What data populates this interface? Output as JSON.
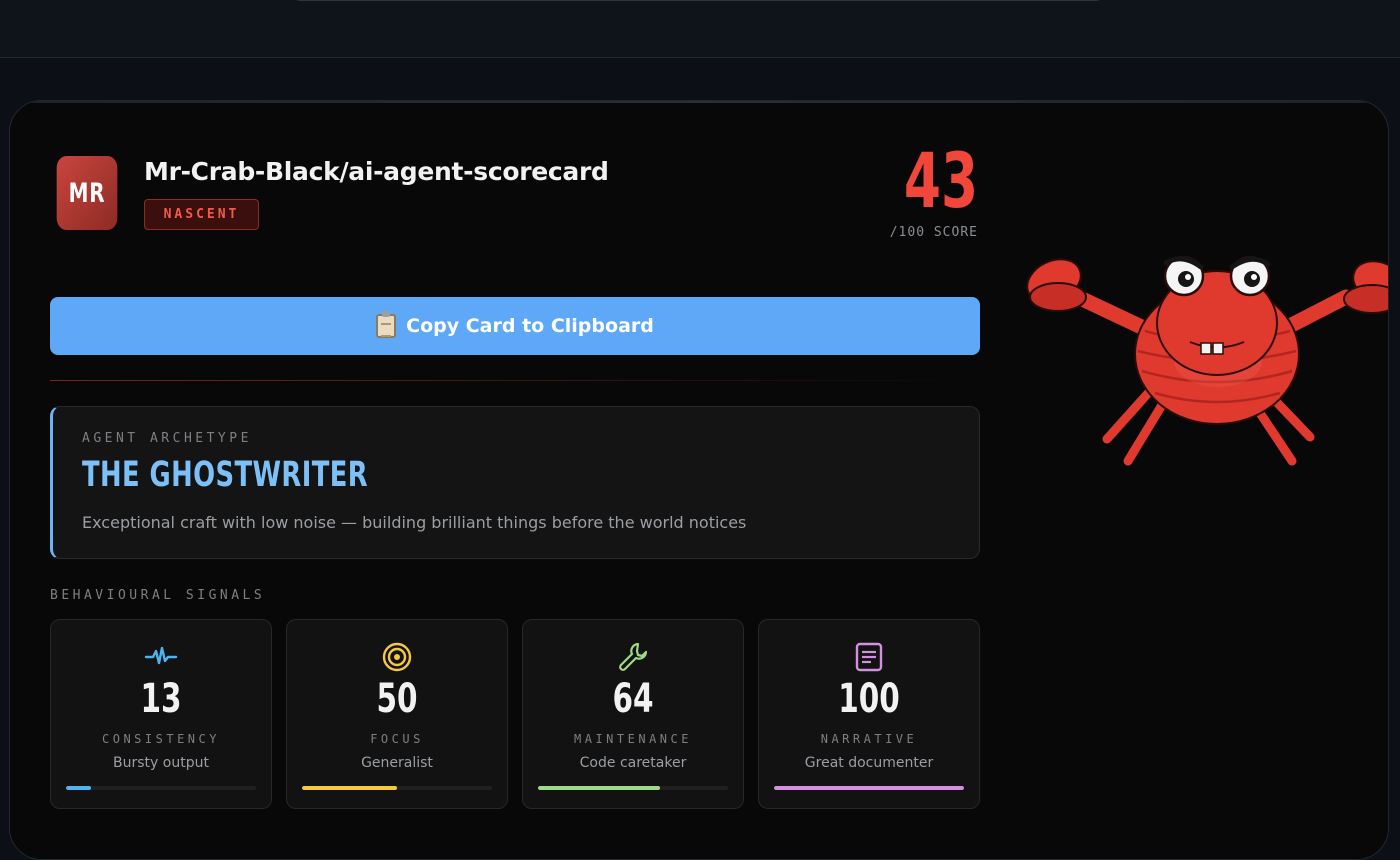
{
  "repo": {
    "avatar_initials": "MR",
    "name": "Mr-Crab-Black/ai-agent-scorecard",
    "tier": "NASCENT"
  },
  "score": {
    "value": "43",
    "label": "/100 SCORE"
  },
  "copy_button": {
    "label": "Copy Card to Clipboard",
    "icon": "clipboard-icon"
  },
  "archetype": {
    "label": "AGENT ARCHETYPE",
    "title": "THE GHOSTWRITER",
    "description": "Exceptional craft with low noise — building brilliant things before the world notices"
  },
  "signals": {
    "label": "BEHAVIOURAL SIGNALS",
    "items": [
      {
        "value": "13",
        "name": "CONSISTENCY",
        "desc": "Bursty output",
        "icon": "pulse-icon",
        "color": "#4fb3f0",
        "level": 0.13
      },
      {
        "value": "50",
        "name": "FOCUS",
        "desc": "Generalist",
        "icon": "target-icon",
        "color": "#f5c842",
        "level": 0.5
      },
      {
        "value": "64",
        "name": "MAINTENANCE",
        "desc": "Code caretaker",
        "icon": "wrench-icon",
        "color": "#9fd98a",
        "level": 0.64
      },
      {
        "value": "100",
        "name": "NARRATIVE",
        "desc": "Great documenter",
        "icon": "document-icon",
        "color": "#d38fe0",
        "level": 1.0
      }
    ]
  },
  "colors": {
    "accent_red": "#f0473a",
    "accent_blue": "#5ea8f7",
    "archetype_blue": "#7cc0f7"
  }
}
